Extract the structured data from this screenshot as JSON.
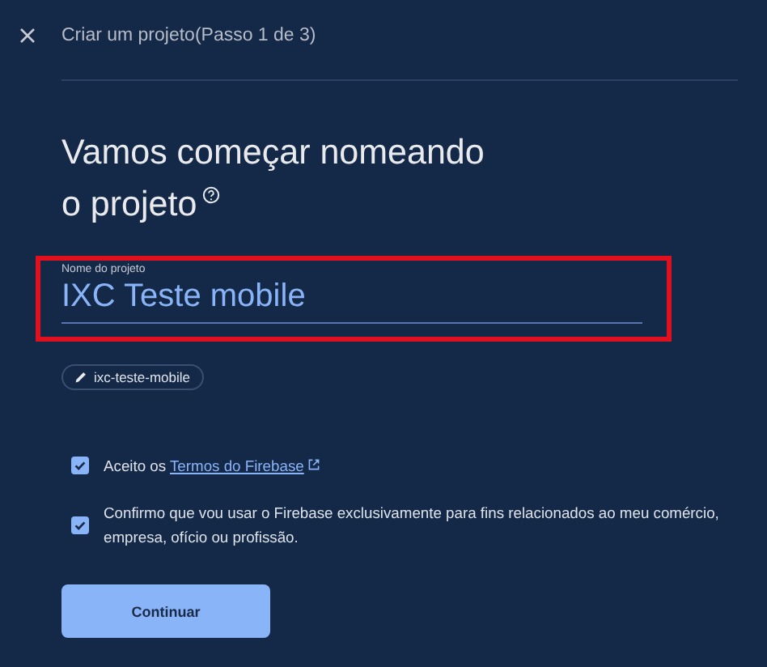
{
  "header": {
    "title": "Criar um projeto(Passo 1 de 3)"
  },
  "heading": {
    "lines": [
      "Vamos começar nomeando",
      "o projeto"
    ]
  },
  "field": {
    "label": "Nome do projeto",
    "value": "IXC Teste mobile",
    "highlighted": true
  },
  "chip": {
    "label": "ixc-teste-mobile"
  },
  "checkboxes": [
    {
      "text": "Aceito os",
      "link": "Termos do Firebase",
      "checked": true
    },
    {
      "text": "Confirmo que vou usar o Firebase exclusivamente para fins relacionados ao meu comércio, empresa, ofício ou profissão.",
      "checked": true
    }
  ],
  "button": {
    "label": "Continuar"
  }
}
